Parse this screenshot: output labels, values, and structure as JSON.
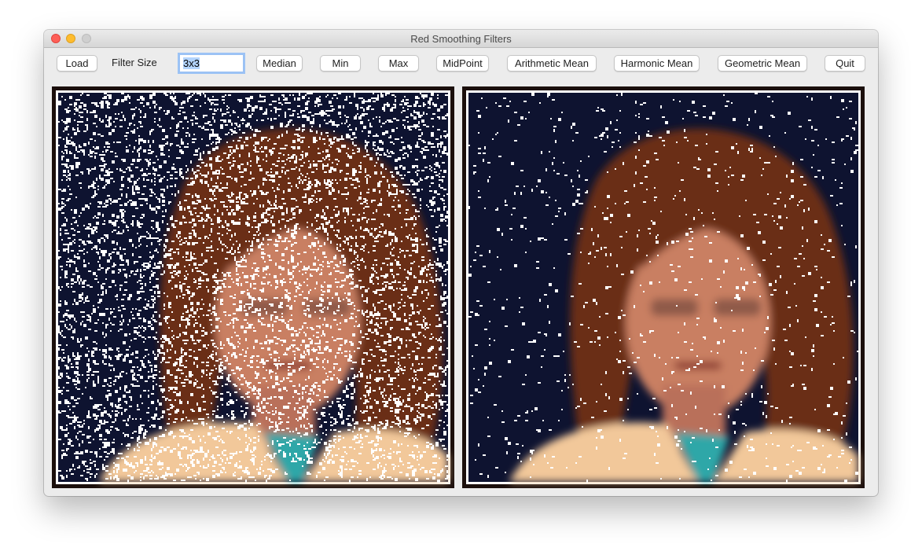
{
  "window": {
    "title": "Red Smoothing Filters"
  },
  "toolbar": {
    "load_label": "Load",
    "filter_size_label": "Filter Size",
    "filter_size_value": "3x3",
    "median_label": "Median",
    "min_label": "Min",
    "max_label": "Max",
    "midpoint_label": "MidPoint",
    "arithmetic_mean_label": "Arithmetic Mean",
    "harmonic_mean_label": "Harmonic Mean",
    "geometric_mean_label": "Geometric Mean",
    "quit_label": "Quit"
  },
  "images": {
    "left": {
      "icon": "noisy-portrait-image",
      "noise_level": "heavy"
    },
    "right": {
      "icon": "filtered-portrait-image",
      "noise_level": "light"
    },
    "colors": {
      "background": "#0e1330",
      "hair": "#6b2e16",
      "skin": "#c97f62",
      "jacket": "#f2c89a",
      "shirt": "#2fa7a8",
      "noise": "#ffffff"
    }
  }
}
